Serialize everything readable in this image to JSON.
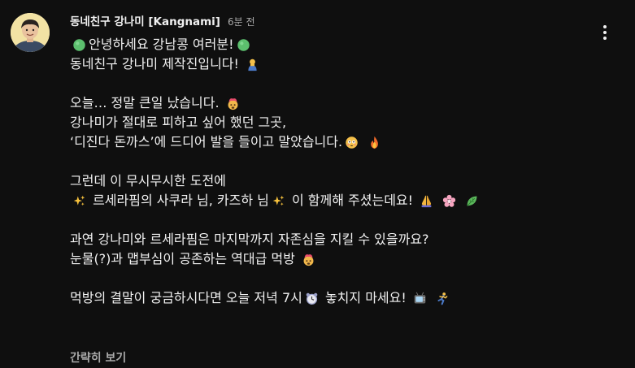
{
  "comment": {
    "channel_name": "동네친구 강나미 [Kangnami]",
    "timestamp": "6분 전",
    "lines": [
      {
        "segments": [
          {
            "icon": "green-circle-icon"
          },
          {
            "text": "안녕하세요 강남콩 여러분!"
          },
          {
            "icon": "green-circle-icon"
          }
        ]
      },
      {
        "segments": [
          {
            "text": "동네친구 강나미 제작진입니다! "
          },
          {
            "icon": "person-bowing-icon"
          }
        ]
      },
      {
        "blank": true
      },
      {
        "segments": [
          {
            "text": "오늘… 정말 큰일 났습니다. "
          },
          {
            "icon": "exploding-head-icon"
          }
        ]
      },
      {
        "segments": [
          {
            "text": "강나미가 절대로 피하고 싶어 했던 그곳,"
          }
        ]
      },
      {
        "segments": [
          {
            "text": "‘디진다 돈까스’에 드디어 발을 들이고 말았습니다."
          },
          {
            "icon": "flushed-face-icon"
          },
          {
            "text": " "
          },
          {
            "icon": "fire-icon"
          }
        ]
      },
      {
        "blank": true
      },
      {
        "segments": [
          {
            "text": "그런데 이 무시무시한 도전에"
          }
        ]
      },
      {
        "segments": [
          {
            "icon": "sparkles-icon"
          },
          {
            "text": " 르세라핌의 사쿠라 님, 카즈하 님"
          },
          {
            "icon": "sparkles-icon"
          },
          {
            "text": " 이 함께해 주셨는데요! "
          },
          {
            "icon": "folded-hands-icon"
          },
          {
            "text": " "
          },
          {
            "icon": "cherry-blossom-icon"
          },
          {
            "text": " "
          },
          {
            "icon": "leaf-icon"
          }
        ]
      },
      {
        "blank": true
      },
      {
        "segments": [
          {
            "text": "과연 강나미와 르세라핌은 마지막까지 자존심을 지킬 수 있을까요?"
          }
        ]
      },
      {
        "segments": [
          {
            "text": "눈물(?)과 맵부심이 공존하는 역대급 먹방 "
          },
          {
            "icon": "exploding-head-icon"
          }
        ]
      },
      {
        "blank": true
      },
      {
        "segments": [
          {
            "text": "먹방의 결말이 궁금하시다면 오늘 저녁 7시"
          },
          {
            "icon": "alarm-clock-icon"
          },
          {
            "text": " 놓치지 마세요! "
          },
          {
            "icon": "television-icon"
          },
          {
            "text": " "
          },
          {
            "icon": "running-person-icon"
          }
        ]
      }
    ],
    "collapse_label": "간략히 보기"
  },
  "colors": {
    "background": "#0f0f0f",
    "primary_text": "#f1f1f1",
    "secondary_text": "#aaaaaa"
  }
}
